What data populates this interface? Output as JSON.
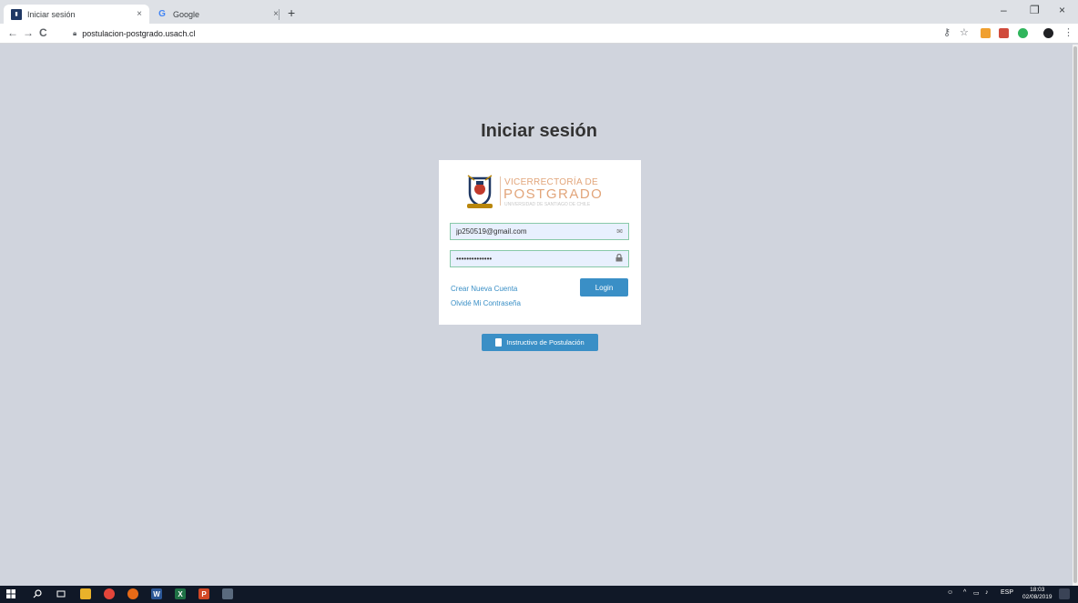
{
  "browser": {
    "tabs": [
      {
        "title": "Iniciar sesión",
        "close": "×"
      },
      {
        "title": "Google",
        "close": "×"
      }
    ],
    "new_tab": "+",
    "window_controls": {
      "minimize": "–",
      "restore": "❐",
      "close": "×"
    },
    "nav": {
      "back": "←",
      "forward": "→",
      "reload": "C"
    },
    "url": "postulacion-postgrado.usach.cl",
    "favicon_google": "G"
  },
  "page": {
    "title": "Iniciar sesión",
    "logo": {
      "line1": "VICERRECTORÍA DE",
      "line2": "POSTGRADO",
      "line3": "UNIVERSIDAD DE SANTIAGO DE CHILE"
    },
    "email_value": "jp250519@gmail.com",
    "password_value": "••••••••••••••",
    "login_label": "Login",
    "create_account": "Crear Nueva Cuenta",
    "forgot_password": "Olvidé Mi Contraseña",
    "instructivo_label": "Instructivo de Postulación"
  },
  "taskbar": {
    "language": "ESP",
    "time": "18:03",
    "date": "02/08/2019"
  },
  "colors": {
    "page_bg": "#d0d4dd",
    "accent": "#3a8fc6",
    "logo_orange": "#e2a57a",
    "field_border": "#88c9a9"
  }
}
